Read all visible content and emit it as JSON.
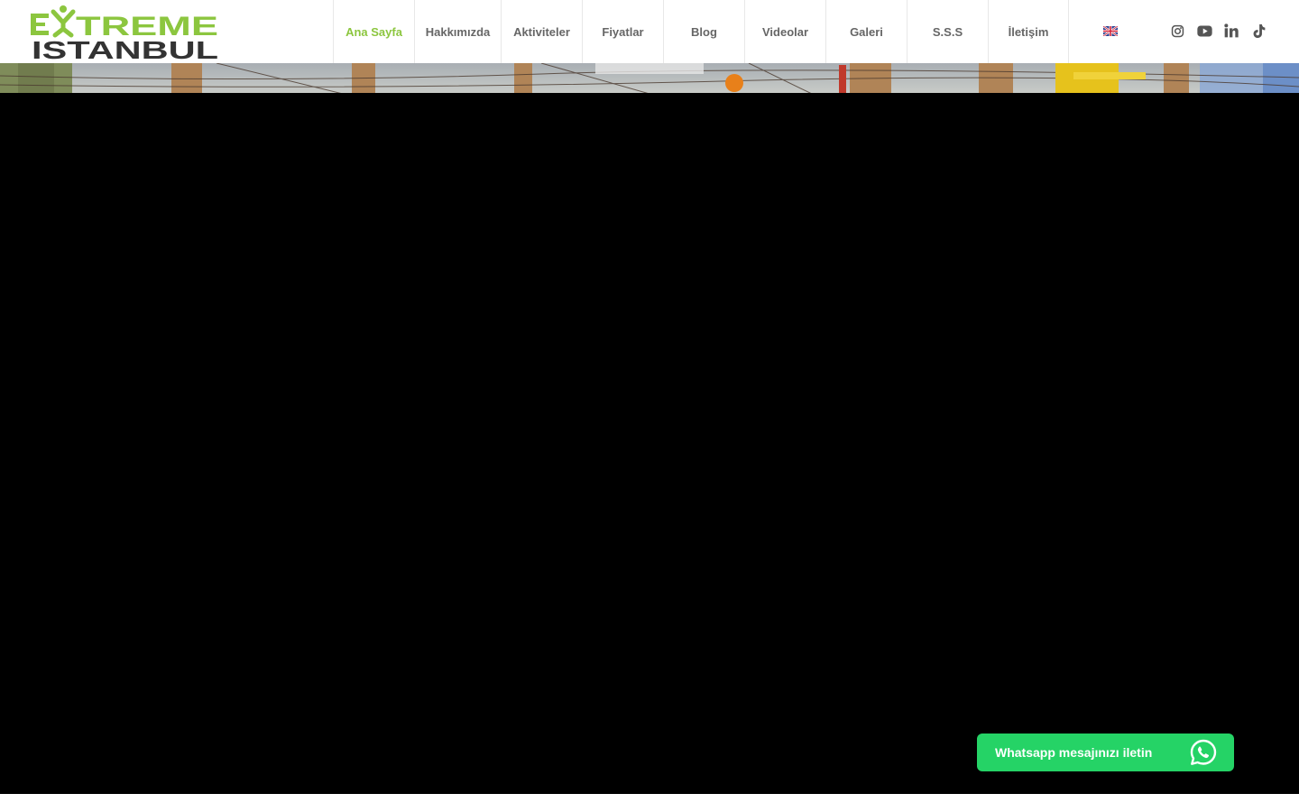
{
  "brand": {
    "logo_line1": "EXTREME",
    "logo_line2": "ISTANBUL",
    "accent_color": "#8cc63f",
    "text_color": "#333333"
  },
  "nav": {
    "items": [
      {
        "label": "Ana Sayfa",
        "active": true
      },
      {
        "label": "Hakkımızda",
        "active": false
      },
      {
        "label": "Aktiviteler",
        "active": false
      },
      {
        "label": "Fiyatlar",
        "active": false
      },
      {
        "label": "Blog",
        "active": false
      },
      {
        "label": "Videolar",
        "active": false
      },
      {
        "label": "Galeri",
        "active": false
      },
      {
        "label": "S.S.S",
        "active": false
      },
      {
        "label": "İletişim",
        "active": false
      }
    ],
    "language_flag": "uk-flag-icon"
  },
  "socials": [
    {
      "icon": "instagram-icon"
    },
    {
      "icon": "youtube-icon"
    },
    {
      "icon": "linkedin-icon"
    },
    {
      "icon": "tiktok-icon"
    }
  ],
  "whatsapp": {
    "label": "Whatsapp mesajınızı iletin",
    "color": "#25d366"
  }
}
